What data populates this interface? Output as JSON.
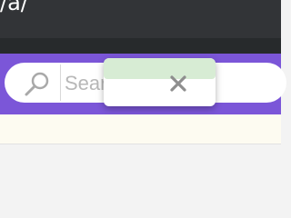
{
  "browser": {
    "url_fragment": "/a/"
  },
  "search": {
    "placeholder": "Search",
    "value": "",
    "icon": "magnifier-icon",
    "clear_icon": "close-icon"
  },
  "colors": {
    "top_bar": "#323437",
    "accent": "#7b56d8",
    "card_tab": "#d7ecd4",
    "cream": "#fdfbf1"
  }
}
